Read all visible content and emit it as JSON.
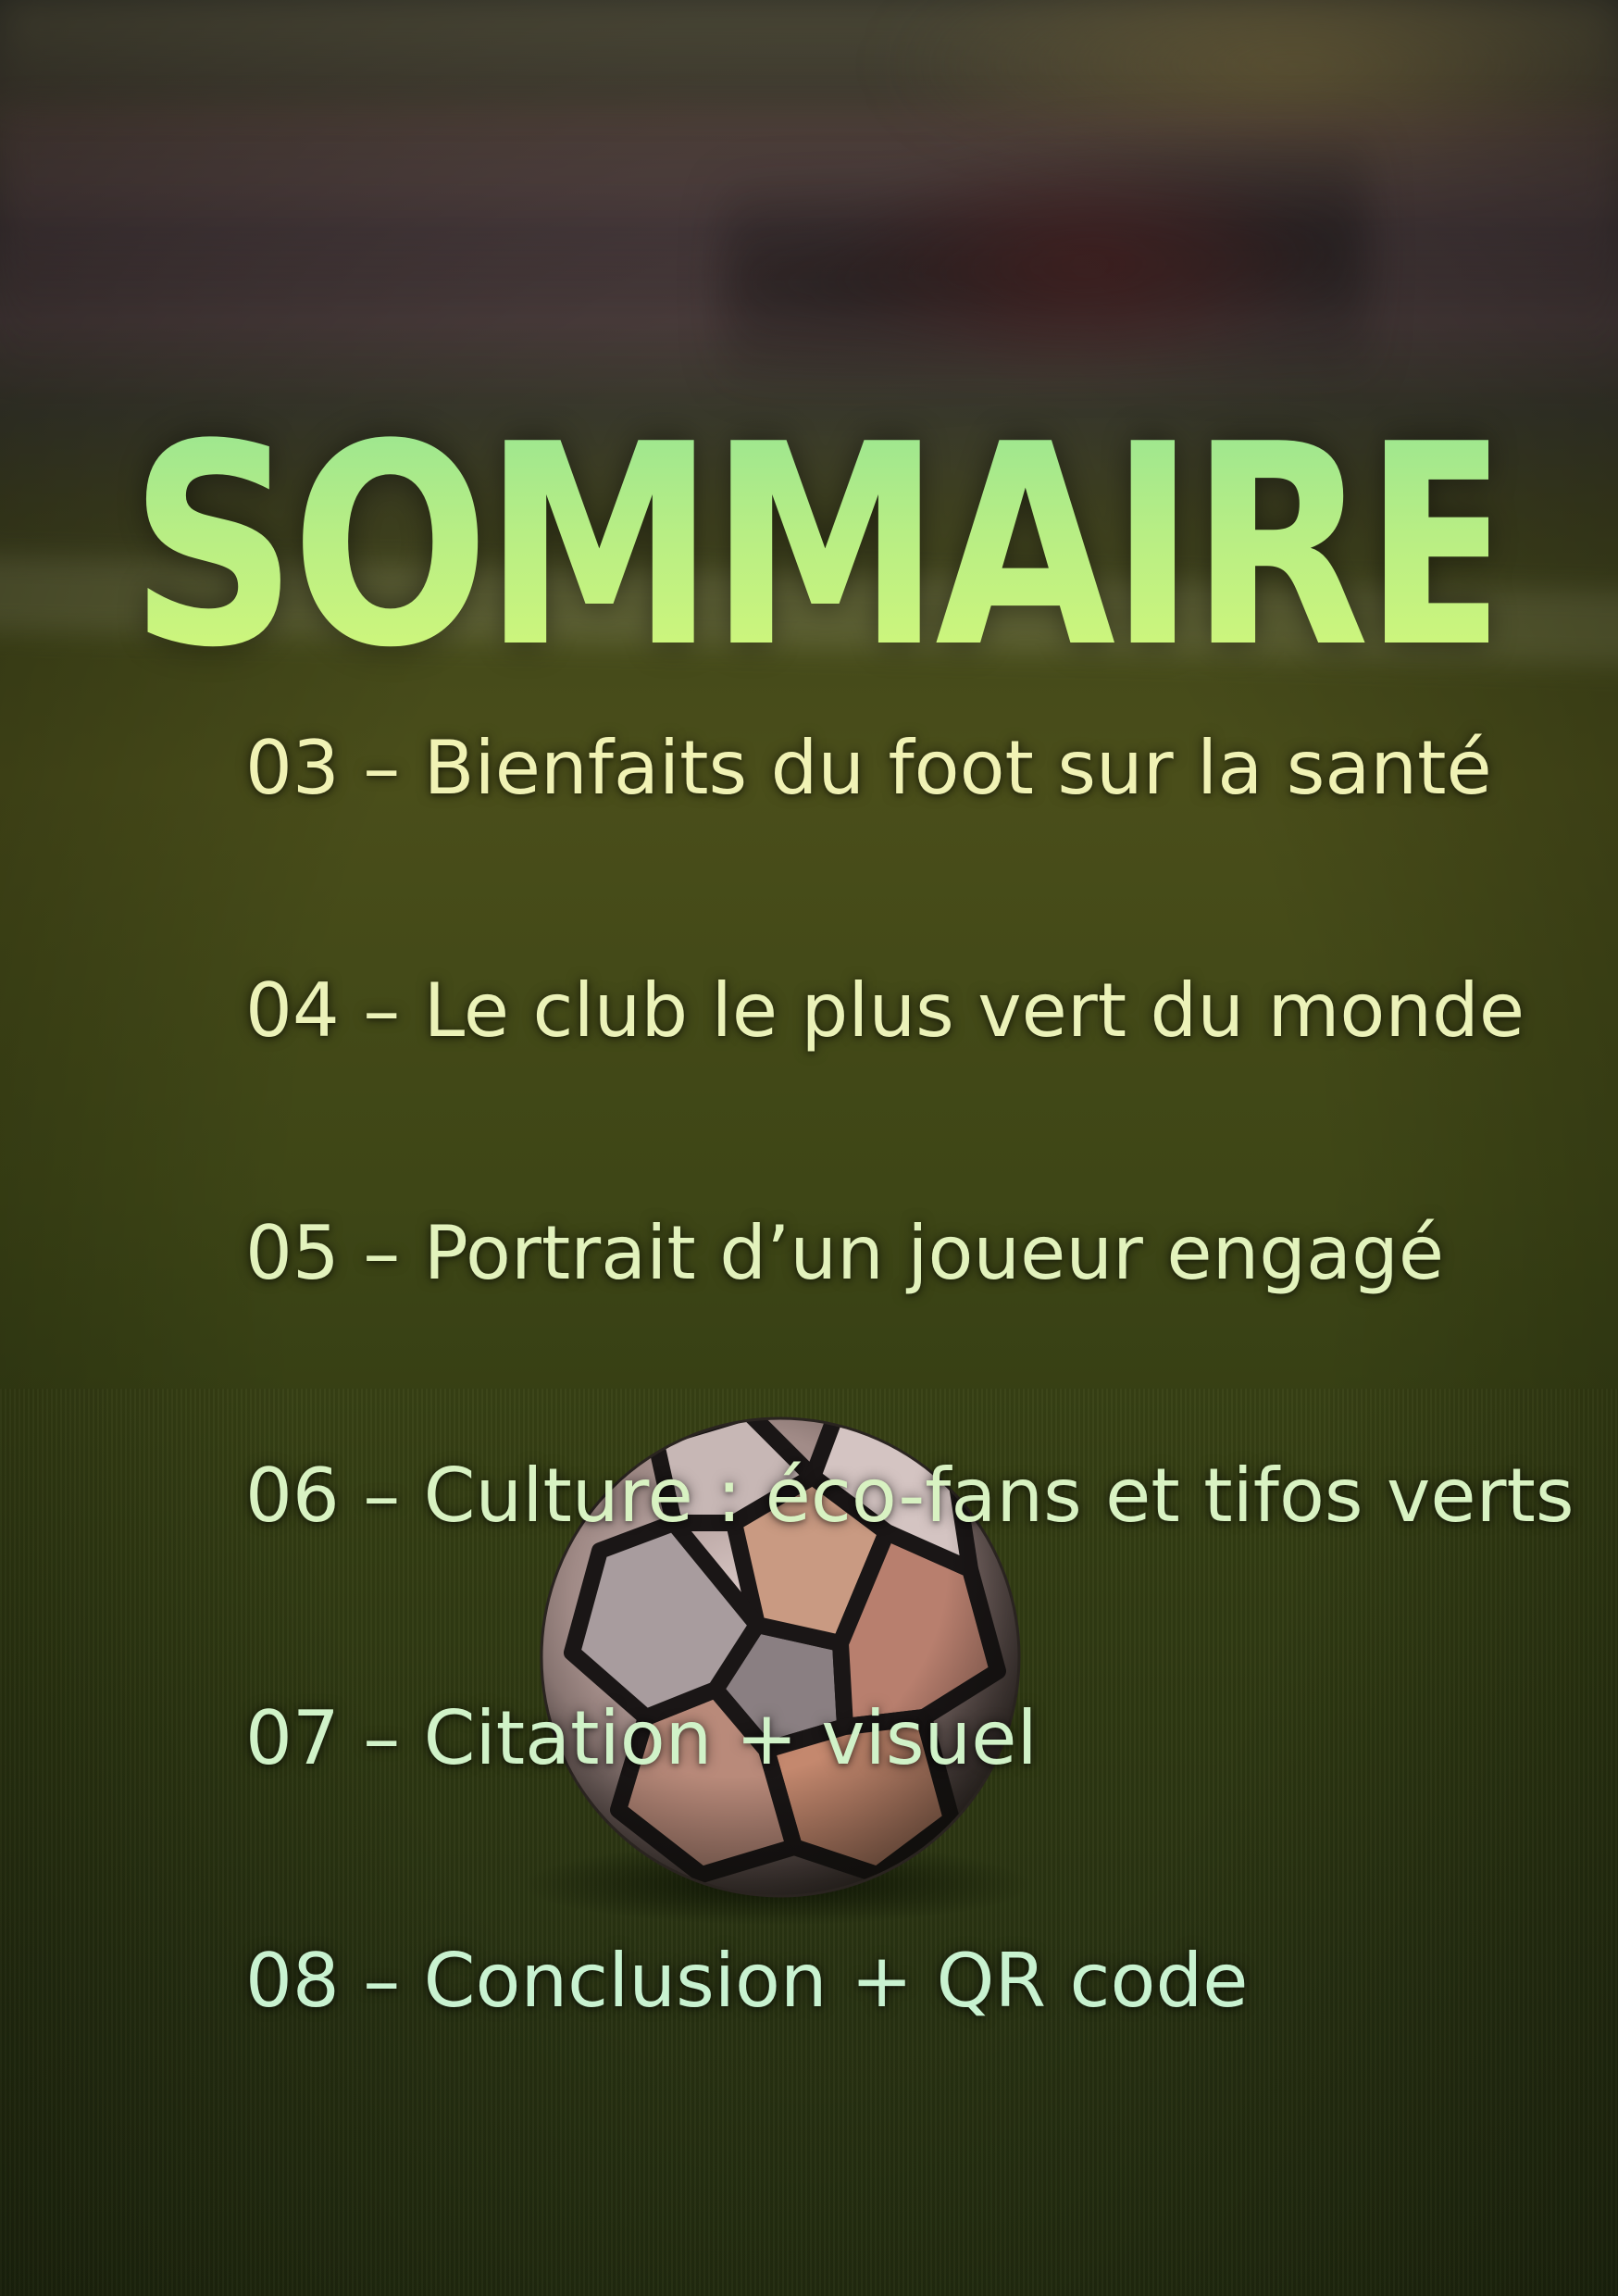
{
  "page": {
    "title": "SOMMAIRE"
  },
  "toc": {
    "items": [
      {
        "text": "03 – Bienfaits du foot sur la santé"
      },
      {
        "text": "04 – Le club le plus vert du monde"
      },
      {
        "text": "05 – Portrait d’un joueur engagé"
      },
      {
        "text": "06 – Culture : éco-fans et tifos verts"
      },
      {
        "text": "07 – Citation + visuel"
      },
      {
        "text": "08 – Conclusion + QR code"
      }
    ]
  },
  "colors": {
    "title_top": "#98e592",
    "title_bottom": "#d4f87a",
    "text_top": "#f0f2b4",
    "text_bottom": "#c8f2d0",
    "background_grass": "#2e3812"
  },
  "background": {
    "subject": "soccer-ball-on-grass"
  }
}
